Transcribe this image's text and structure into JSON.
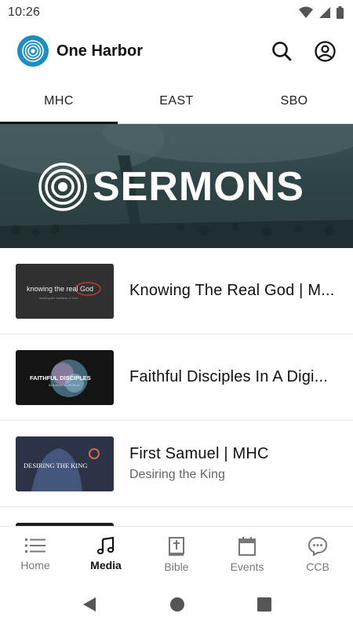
{
  "status_bar": {
    "time": "10:26"
  },
  "header": {
    "app_title": "One Harbor"
  },
  "tabs": [
    {
      "label": "MHC",
      "active": true
    },
    {
      "label": "EAST",
      "active": false
    },
    {
      "label": "SBO",
      "active": false
    }
  ],
  "banner": {
    "title": "SERMONS"
  },
  "sermons": [
    {
      "title": "Knowing The Real God | M...",
      "subtitle": "",
      "thumb_text": "knowing the real God",
      "thumb_caption": "seeking the holiness of God"
    },
    {
      "title": "Faithful Disciples In A Digi...",
      "subtitle": "",
      "thumb_text": "FAITHFUL DISCIPLES",
      "thumb_caption": "IN A DIGITAL WORLD"
    },
    {
      "title": "First Samuel | MHC",
      "subtitle": "Desiring the King",
      "thumb_text": "DESIRING THE KING",
      "thumb_caption": ""
    }
  ],
  "bottom_nav": [
    {
      "label": "Home",
      "icon": "list-icon",
      "active": false
    },
    {
      "label": "Media",
      "icon": "music-note-icon",
      "active": true
    },
    {
      "label": "Bible",
      "icon": "bible-icon",
      "active": false
    },
    {
      "label": "Events",
      "icon": "calendar-icon",
      "active": false
    },
    {
      "label": "CCB",
      "icon": "chat-bubble-icon",
      "active": false
    }
  ],
  "colors": {
    "brand": "#1f8dbd",
    "banner": "#2f4446",
    "active_text": "#111111",
    "inactive_text": "#777777"
  }
}
